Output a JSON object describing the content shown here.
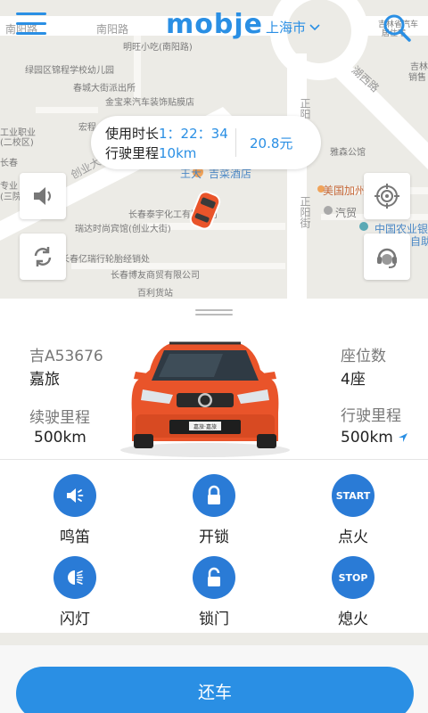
{
  "header": {
    "logo": "mobje",
    "city": "上海市"
  },
  "map": {
    "labels": {
      "nanyang_1": "南阳路",
      "nanyang_2": "南阳路",
      "mingwang": "明旺小吃(南阳路)",
      "lvyuan": "绿园区锦程学校幼儿园",
      "chunchengst": "春城大街派出所",
      "jinbaolai": "金宝来汽车装饰贴膜店",
      "hongcheng": "宏程",
      "gongye": "工业职业",
      "gongye2": "(二校区)",
      "changchun_r": "长春",
      "zhuanye": "专业",
      "sanzheng": "(三院)",
      "chuangye": "创业大",
      "hunan_road": "湖西路",
      "zhengyang_1": "正阳",
      "zhengyang_2": "正阳街",
      "yagao": "雅森公馆",
      "wangda": "王大",
      "jingcai": "吉菜酒店",
      "meiguo": "美国加州",
      "qimao": "汽贸",
      "nongye": "中国农业银",
      "nongye2": "自助",
      "jilin": "吉林",
      "jilin2": "销售",
      "jishi": "吉林省汽车",
      "jishi2": "居住宅",
      "taiyuzhu": "长春泰宇化工有限公司",
      "ruida": "瑞达时尚宾馆(创业大街)",
      "yixing": "长春亿瑞行轮胎经销处",
      "bohua": "长春博友商贸有限公司",
      "baili": "百利货站"
    }
  },
  "ride": {
    "time_label": "使用时长",
    "time_value": "1：22：34",
    "distance_label": "行驶里程",
    "distance_value": "10km",
    "cost": "20.8元"
  },
  "car": {
    "plate": "吉A53676",
    "model": "嘉旅",
    "seats_label": "座位数",
    "seats_value": "4座",
    "range_label": "续驶里程",
    "range_value": "500km",
    "mileage_label": "行驶里程",
    "mileage_value": "500km",
    "badge": "嘉旅·嘉旅"
  },
  "controls": {
    "honk": "鸣笛",
    "unlock": "开锁",
    "start": "点火",
    "start_text": "START",
    "flash": "闪灯",
    "lock": "锁门",
    "stop": "熄火",
    "stop_text": "STOP"
  },
  "actions": {
    "return_car": "还车"
  },
  "colors": {
    "primary": "#2a8fe4",
    "control_circle": "#2a7bd6",
    "car_body": "#e9542a"
  },
  "icons": {
    "menu": "hamburger-icon",
    "search": "search-icon",
    "city_dropdown": "chevron-down-icon",
    "speaker": "speaker-icon",
    "refresh": "refresh-icon",
    "target": "target-icon",
    "support": "customer-service-icon",
    "navigation": "navigation-arrow-icon"
  }
}
